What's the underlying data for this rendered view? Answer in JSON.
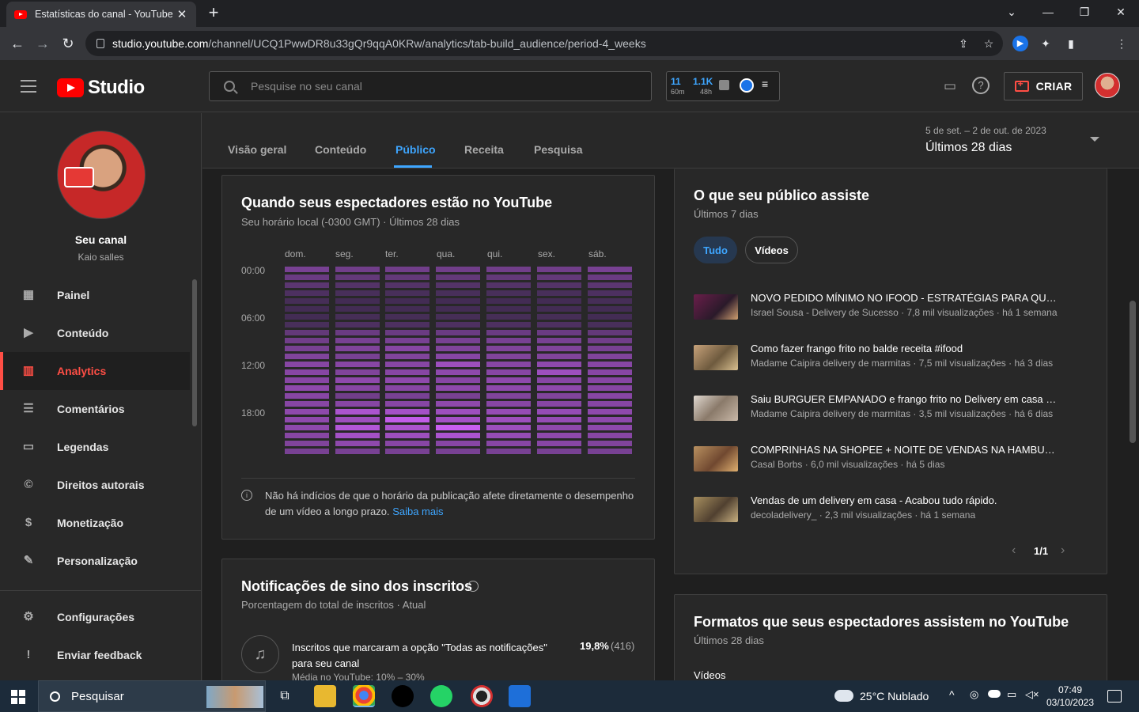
{
  "browser": {
    "tab_title": "Estatísticas do canal - YouTube S",
    "url_host": "studio.youtube.com",
    "url_path": "/channel/UCQ1PwwDR8u33gQr9qqA0KRw/analytics/tab-build_audience/period-4_weeks"
  },
  "header": {
    "logo_text": "Studio",
    "search_placeholder": "Pesquise no seu canal",
    "stats": {
      "v1": "11",
      "v1_sub": "60m",
      "v2": "1.1K",
      "v2_sub": "48h"
    },
    "create_label": "CRIAR"
  },
  "sidebar": {
    "channel_title": "Seu canal",
    "channel_name": "Kaio salles",
    "avatar_sign": "ifood",
    "items": [
      {
        "label": "Painel",
        "icon": "dashboard-icon"
      },
      {
        "label": "Conteúdo",
        "icon": "content-icon"
      },
      {
        "label": "Analytics",
        "icon": "analytics-icon",
        "active": true
      },
      {
        "label": "Comentários",
        "icon": "comments-icon"
      },
      {
        "label": "Legendas",
        "icon": "subtitles-icon"
      },
      {
        "label": "Direitos autorais",
        "icon": "copyright-icon"
      },
      {
        "label": "Monetização",
        "icon": "monetization-icon"
      },
      {
        "label": "Personalização",
        "icon": "customization-icon"
      }
    ],
    "bottom_items": [
      {
        "label": "Configurações",
        "icon": "settings-icon"
      },
      {
        "label": "Enviar feedback",
        "icon": "feedback-icon"
      }
    ]
  },
  "analytics_tabs": [
    "Visão geral",
    "Conteúdo",
    "Público",
    "Receita",
    "Pesquisa"
  ],
  "active_tab": "Público",
  "date_range": {
    "dates": "5 de set. – 2 de out. de 2023",
    "label": "Últimos 28 dias"
  },
  "when_card": {
    "title": "Quando seus espectadores estão no YouTube",
    "subtitle": "Seu horário local (-0300 GMT) · Últimos 28 dias",
    "days": [
      "dom.",
      "seg.",
      "ter.",
      "qua.",
      "qui.",
      "sex.",
      "sáb."
    ],
    "hours": [
      "00:00",
      "06:00",
      "12:00",
      "18:00"
    ],
    "note": "Não há indícios de que o horário da publicação afete diretamente o desempenho de um vídeo a longo prazo.",
    "note_link": "Saiba mais"
  },
  "bell_card": {
    "title": "Notificações de sino dos inscritos",
    "subtitle": "Porcentagem do total de inscritos · Atual",
    "row_label": "Inscritos que marcaram a opção \"Todas as notificações\" para seu canal",
    "row_value": "19,8%",
    "row_count": "(416)",
    "row_avg": "Média no YouTube: 10% – 30%"
  },
  "watch_card": {
    "title": "O que seu público assiste",
    "subtitle": "Últimos 7 dias",
    "chips": [
      "Tudo",
      "Vídeos"
    ],
    "videos": [
      {
        "title": "NOVO PEDIDO MÍNIMO NO IFOOD - ESTRATÉGIAS PARA QUEM USA IFOOD",
        "meta": "Israel Sousa - Delivery de Sucesso · 7,8 mil visualizações · há 1 semana",
        "thumb": "#5a2a3a"
      },
      {
        "title": "Como fazer frango frito no balde receita #ifood",
        "meta": "Madame Caipira delivery de marmitas · 7,5 mil visualizações · há 3 dias",
        "thumb": "#8a6a4a"
      },
      {
        "title": "Saiu BURGUER EMPANADO e frango frito no Delivery em casa vendendo",
        "meta": "Madame Caipira delivery de marmitas · 3,5 mil visualizações · há 6 dias",
        "thumb": "#b8b0a8"
      },
      {
        "title": "COMPRINHAS NA SHOPEE + NOITE DE VENDAS NA HAMBURGUERIA",
        "meta": "Casal Borbs · 6,0 mil visualizações · há 5 dias",
        "thumb": "#9a7a5a"
      },
      {
        "title": "Vendas de um delivery em casa - Acabou tudo rápido.",
        "meta": "decoladelivery_ · 2,3 mil visualizações · há 1 semana",
        "thumb": "#7a6a4a"
      }
    ],
    "pager": "1/1"
  },
  "formats_card": {
    "title": "Formatos que seus espectadores assistem no YouTube",
    "subtitle": "Últimos 28 dias",
    "first_label": "Vídeos"
  },
  "taskbar": {
    "search_label": "Pesquisar",
    "weather": "25°C  Nublado",
    "time": "07:49",
    "date": "03/10/2023"
  },
  "chart_data": {
    "type": "heatmap",
    "title": "Quando seus espectadores estão no YouTube",
    "x": [
      "dom.",
      "seg.",
      "ter.",
      "qua.",
      "qui.",
      "sex.",
      "sáb."
    ],
    "y_ticks": [
      "00:00",
      "06:00",
      "12:00",
      "18:00"
    ],
    "rows_per_day": 24,
    "values": [
      [
        0.45,
        0.35,
        0.25,
        0.15,
        0.1,
        0.08,
        0.08,
        0.12,
        0.3,
        0.4,
        0.45,
        0.5,
        0.55,
        0.55,
        0.55,
        0.6,
        0.55,
        0.55,
        0.6,
        0.6,
        0.6,
        0.55,
        0.5,
        0.45
      ],
      [
        0.4,
        0.3,
        0.2,
        0.12,
        0.08,
        0.08,
        0.1,
        0.15,
        0.35,
        0.45,
        0.5,
        0.45,
        0.55,
        0.5,
        0.6,
        0.55,
        0.4,
        0.55,
        0.8,
        0.7,
        0.85,
        0.75,
        0.6,
        0.45
      ],
      [
        0.4,
        0.3,
        0.2,
        0.12,
        0.08,
        0.08,
        0.1,
        0.15,
        0.35,
        0.45,
        0.55,
        0.5,
        0.55,
        0.55,
        0.6,
        0.55,
        0.45,
        0.55,
        0.75,
        0.95,
        0.8,
        0.7,
        0.55,
        0.45
      ],
      [
        0.4,
        0.3,
        0.2,
        0.12,
        0.08,
        0.08,
        0.1,
        0.15,
        0.35,
        0.45,
        0.5,
        0.55,
        0.7,
        0.6,
        0.55,
        0.6,
        0.45,
        0.6,
        0.7,
        0.75,
        1.0,
        0.8,
        0.55,
        0.45
      ],
      [
        0.4,
        0.3,
        0.2,
        0.12,
        0.08,
        0.08,
        0.1,
        0.15,
        0.35,
        0.45,
        0.5,
        0.5,
        0.55,
        0.55,
        0.6,
        0.6,
        0.5,
        0.55,
        0.65,
        0.7,
        0.7,
        0.65,
        0.55,
        0.45
      ],
      [
        0.4,
        0.3,
        0.2,
        0.12,
        0.08,
        0.08,
        0.1,
        0.15,
        0.35,
        0.45,
        0.5,
        0.5,
        0.6,
        0.7,
        0.55,
        0.6,
        0.5,
        0.55,
        0.65,
        0.65,
        0.6,
        0.6,
        0.55,
        0.45
      ],
      [
        0.45,
        0.35,
        0.25,
        0.15,
        0.1,
        0.08,
        0.08,
        0.12,
        0.3,
        0.4,
        0.45,
        0.5,
        0.55,
        0.55,
        0.55,
        0.55,
        0.55,
        0.55,
        0.6,
        0.6,
        0.6,
        0.55,
        0.5,
        0.45
      ]
    ]
  }
}
